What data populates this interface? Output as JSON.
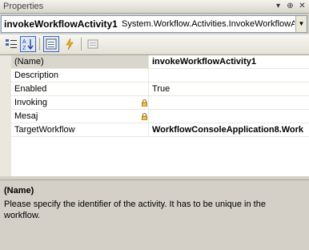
{
  "window": {
    "title": "Properties"
  },
  "titlebar_controls": [
    "▾",
    "⊕",
    "✕"
  ],
  "object_selector": {
    "name": "invokeWorkflowActivity1",
    "type": "System.Workflow.Activities.InvokeWorkflowA"
  },
  "toolbar": {
    "icons": [
      "categorized-icon",
      "alphabetical-icon",
      "properties-icon",
      "events-icon",
      "property-pages-icon"
    ]
  },
  "properties": [
    {
      "name": "(Name)",
      "value": "invokeWorkflowActivity1",
      "bold": true,
      "selected": true,
      "locked": false
    },
    {
      "name": "Description",
      "value": "",
      "bold": false,
      "selected": false,
      "locked": false
    },
    {
      "name": "Enabled",
      "value": "True",
      "bold": false,
      "selected": false,
      "locked": false
    },
    {
      "name": "Invoking",
      "value": "",
      "bold": false,
      "selected": false,
      "locked": true
    },
    {
      "name": "Mesaj",
      "value": "",
      "bold": false,
      "selected": false,
      "locked": true
    },
    {
      "name": "TargetWorkflow",
      "value": "WorkflowConsoleApplication8.Work",
      "bold": true,
      "selected": false,
      "locked": false
    }
  ],
  "description": {
    "title": "(Name)",
    "text": "Please specify the identifier of the activity. It has to be unique in the workflow."
  }
}
